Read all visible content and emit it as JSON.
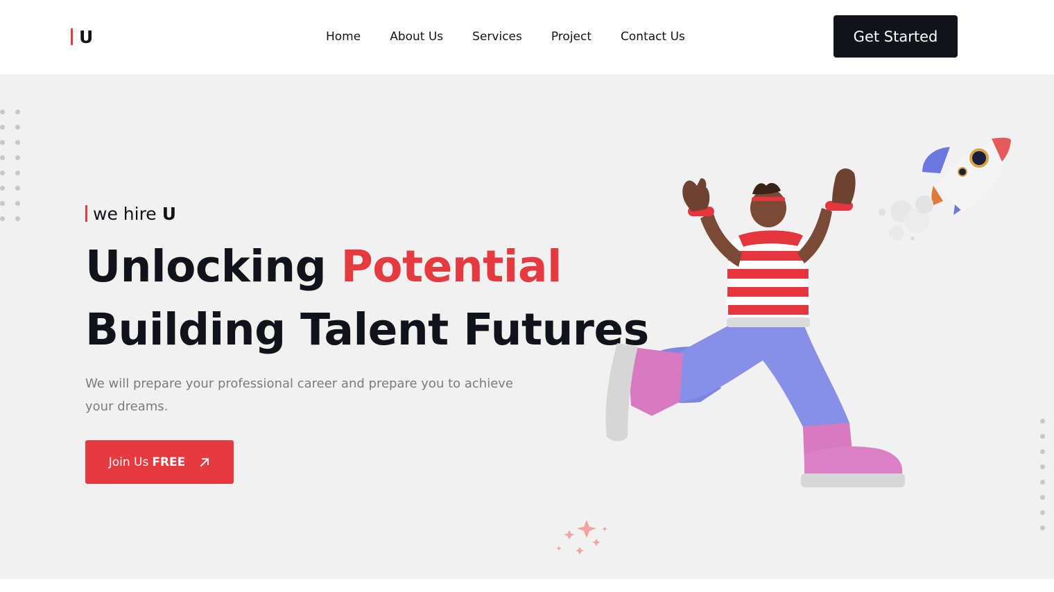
{
  "header": {
    "logo": "U",
    "nav": [
      "Home",
      "About Us",
      "Services",
      "Project",
      "Contact Us"
    ],
    "cta_label": "Get Started"
  },
  "hero": {
    "eyebrow_prefix": "we hire",
    "eyebrow_emphasis": "U",
    "headline_line1_start": "Unlocking",
    "headline_line1_accent": "Potential",
    "headline_line2": "Building Talent Futures",
    "subtitle": "We will prepare your professional career and prepare you to achieve your dreams.",
    "join_label": "Join Us",
    "join_emphasis": "FREE"
  },
  "colors": {
    "accent": "#e53a40",
    "dark": "#11131a",
    "hero_bg": "#f1f1f1",
    "muted_text": "#7b7b7b"
  },
  "icons": {
    "cta_arrow": "arrow-up-right-icon",
    "illustration": "running-person-3d-illustration",
    "rocket": "rocket-illustration",
    "sparkles": "sparkle-icon"
  }
}
